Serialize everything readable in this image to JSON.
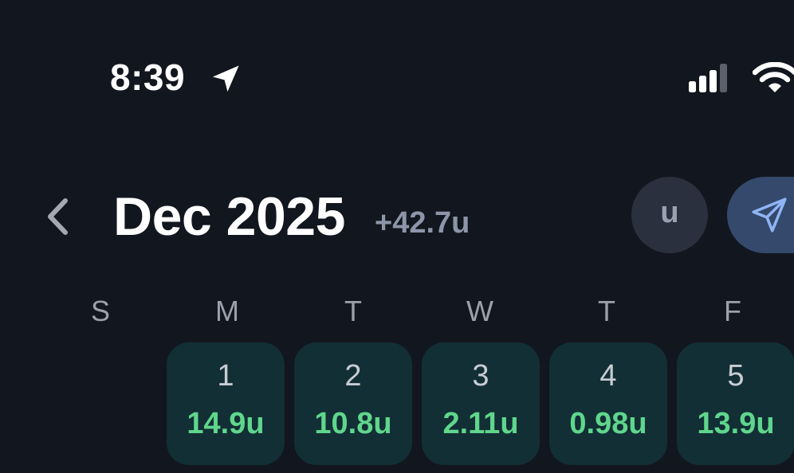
{
  "status_bar": {
    "time": "8:39",
    "location_icon": "location-arrow-icon",
    "signal_icon": "cellular-signal-icon",
    "wifi_icon": "wifi-icon"
  },
  "header": {
    "back_icon": "chevron-left-icon",
    "month": "Dec 2025",
    "total": "+42.7u",
    "unit_button_label": "u",
    "share_icon": "paper-plane-icon"
  },
  "weekdays": [
    "S",
    "M",
    "T",
    "W",
    "T",
    "F"
  ],
  "days": [
    {
      "day": "1",
      "value": "14.9u"
    },
    {
      "day": "2",
      "value": "10.8u"
    },
    {
      "day": "3",
      "value": "2.11u"
    },
    {
      "day": "4",
      "value": "0.98u"
    },
    {
      "day": "5",
      "value": "13.9u"
    }
  ],
  "colors": {
    "background": "#12161e",
    "cell_background": "#122f35",
    "positive_value": "#5fd68c",
    "muted_text": "#8d96a8",
    "unit_button": "#2a303d",
    "share_button": "#34496b",
    "share_icon": "#8fb4f5"
  }
}
